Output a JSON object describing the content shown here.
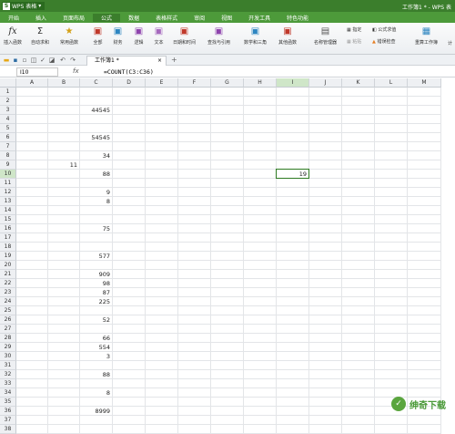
{
  "app": {
    "name": "WPS 表格",
    "window_title": "工作簿1 * - WPS 表"
  },
  "menu": [
    "开始",
    "插入",
    "页面布局",
    "公式",
    "数据",
    "表格样式",
    "审阅",
    "视图",
    "开发工具",
    "特色功能"
  ],
  "ribbon": {
    "buttons": [
      "插入函数",
      "自动求和",
      "常用函数",
      "全部",
      "财务",
      "逻辑",
      "文本",
      "日期和时间",
      "查找与引用",
      "数学和三角",
      "其他函数",
      "名称管理器"
    ],
    "small": [
      "指定",
      "粘贴",
      "公式求值",
      "错误检查",
      "重算工作簿",
      "计"
    ]
  },
  "doc_tab": {
    "label": "工作簿1 *"
  },
  "formula_bar": {
    "name_box": "I10",
    "fx": "fx",
    "formula": "=COUNT(C3:C36)"
  },
  "columns": [
    "A",
    "B",
    "C",
    "D",
    "E",
    "F",
    "G",
    "H",
    "I",
    "J",
    "K",
    "L",
    "M"
  ],
  "active_column": "I",
  "active_row": 10,
  "rows": [
    "1",
    "2",
    "3",
    "4",
    "5",
    "6",
    "7",
    "8",
    "9",
    "10",
    "11",
    "12",
    "13",
    "14",
    "15",
    "16",
    "17",
    "18",
    "19",
    "20",
    "21",
    "22",
    "23",
    "24",
    "25",
    "26",
    "27",
    "28",
    "29",
    "30",
    "31",
    "32",
    "33",
    "34",
    "35",
    "36",
    "37",
    "38"
  ],
  "cells": [
    {
      "ref": "C3",
      "value": "44545"
    },
    {
      "ref": "C6",
      "value": "54545"
    },
    {
      "ref": "C8",
      "value": "34"
    },
    {
      "ref": "B9",
      "value": "11"
    },
    {
      "ref": "C10",
      "value": "88"
    },
    {
      "ref": "I10",
      "value": "19"
    },
    {
      "ref": "C12",
      "value": "9"
    },
    {
      "ref": "C13",
      "value": "8"
    },
    {
      "ref": "C16",
      "value": "75"
    },
    {
      "ref": "C19",
      "value": "577"
    },
    {
      "ref": "C21",
      "value": "909"
    },
    {
      "ref": "C22",
      "value": "98"
    },
    {
      "ref": "C23",
      "value": "87"
    },
    {
      "ref": "C24",
      "value": "225"
    },
    {
      "ref": "C26",
      "value": "52"
    },
    {
      "ref": "C28",
      "value": "66"
    },
    {
      "ref": "C29",
      "value": "554"
    },
    {
      "ref": "C30",
      "value": "3"
    },
    {
      "ref": "C32",
      "value": "88"
    },
    {
      "ref": "C34",
      "value": "8"
    },
    {
      "ref": "C36",
      "value": "8999"
    }
  ],
  "watermark": "绅奇下载"
}
